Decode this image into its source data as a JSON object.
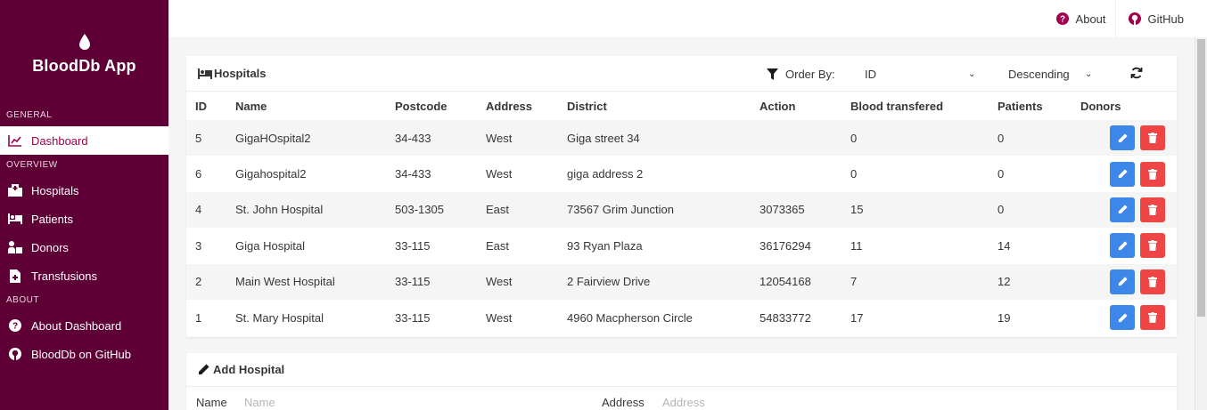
{
  "sidebar": {
    "brand": "BloodDb App",
    "sections": [
      {
        "label": "General",
        "items": [
          {
            "label": "Dashboard",
            "icon": "chart-line-icon",
            "active": true
          }
        ]
      },
      {
        "label": "Overview",
        "items": [
          {
            "label": "Hospitals",
            "icon": "hospital-icon"
          },
          {
            "label": "Patients",
            "icon": "bed-icon"
          },
          {
            "label": "Donors",
            "icon": "donor-icon"
          },
          {
            "label": "Transfusions",
            "icon": "file-medical-icon"
          }
        ]
      },
      {
        "label": "About",
        "items": [
          {
            "label": "About Dashboard",
            "icon": "question-circle-icon"
          },
          {
            "label": "BloodDb on GitHub",
            "icon": "github-icon"
          }
        ]
      }
    ]
  },
  "topbar": {
    "about": "About",
    "github": "GitHub"
  },
  "hospitals_card": {
    "title": "Hospitals",
    "order_by_label": "Order By:",
    "order_by_value": "ID",
    "direction_value": "Descending",
    "columns": [
      "ID",
      "Name",
      "Postcode",
      "Address",
      "District",
      "Action",
      "Blood transfered",
      "Patients",
      "Donors"
    ],
    "rows": [
      [
        "5",
        "GigaHOspital2",
        "34-433",
        "West",
        "Giga street 34",
        "",
        "0",
        "0",
        ""
      ],
      [
        "6",
        "Gigahospital2",
        "34-433",
        "West",
        "giga address 2",
        "",
        "0",
        "0",
        ""
      ],
      [
        "4",
        "St. John Hospital",
        "503-1305",
        "East",
        "73567 Grim Junction",
        "3073365",
        "15",
        "0",
        ""
      ],
      [
        "3",
        "Giga Hospital",
        "33-115",
        "East",
        "93 Ryan Plaza",
        "36176294",
        "11",
        "14",
        ""
      ],
      [
        "2",
        "Main West Hospital",
        "33-115",
        "West",
        "2 Fairview Drive",
        "12054168",
        "7",
        "12",
        ""
      ],
      [
        "1",
        "St. Mary Hospital",
        "33-115",
        "West",
        "4960 Macpherson Circle",
        "54833772",
        "17",
        "19",
        ""
      ]
    ]
  },
  "add_card": {
    "title": "Add Hospital",
    "name_label": "Name",
    "name_placeholder": "Name",
    "address_label": "Address",
    "address_placeholder": "Address"
  },
  "colors": {
    "sidebar": "#5e0036",
    "accent": "#a0004d",
    "edit": "#3d87e8",
    "delete": "#ef4545"
  }
}
